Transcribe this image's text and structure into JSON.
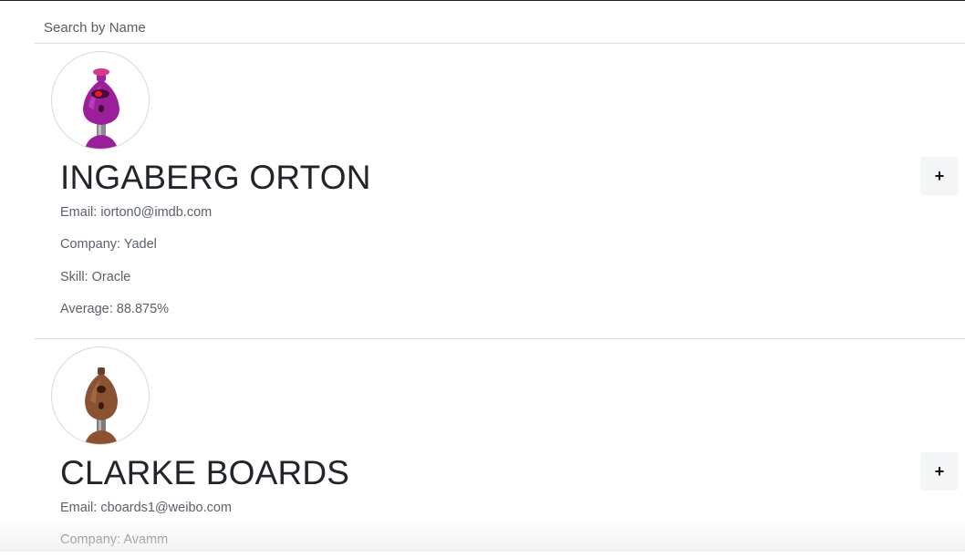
{
  "search": {
    "placeholder": "Search by Name",
    "value": ""
  },
  "students": [
    {
      "name": "INGABERG ORTON",
      "email": "Email: iorton0@imdb.com",
      "company": "Company: Yadel",
      "skill": "Skill: Oracle",
      "average": "Average: 88.875%",
      "expand_label": "+",
      "avatar_icon": "purple-robot-icon",
      "avatar_color": "#9b1f9b"
    },
    {
      "name": "CLARKE BOARDS",
      "email": "Email: cboards1@weibo.com",
      "company": "Company: Avamm",
      "expand_label": "+",
      "avatar_icon": "brown-robot-icon",
      "avatar_color": "#8b5232"
    }
  ]
}
